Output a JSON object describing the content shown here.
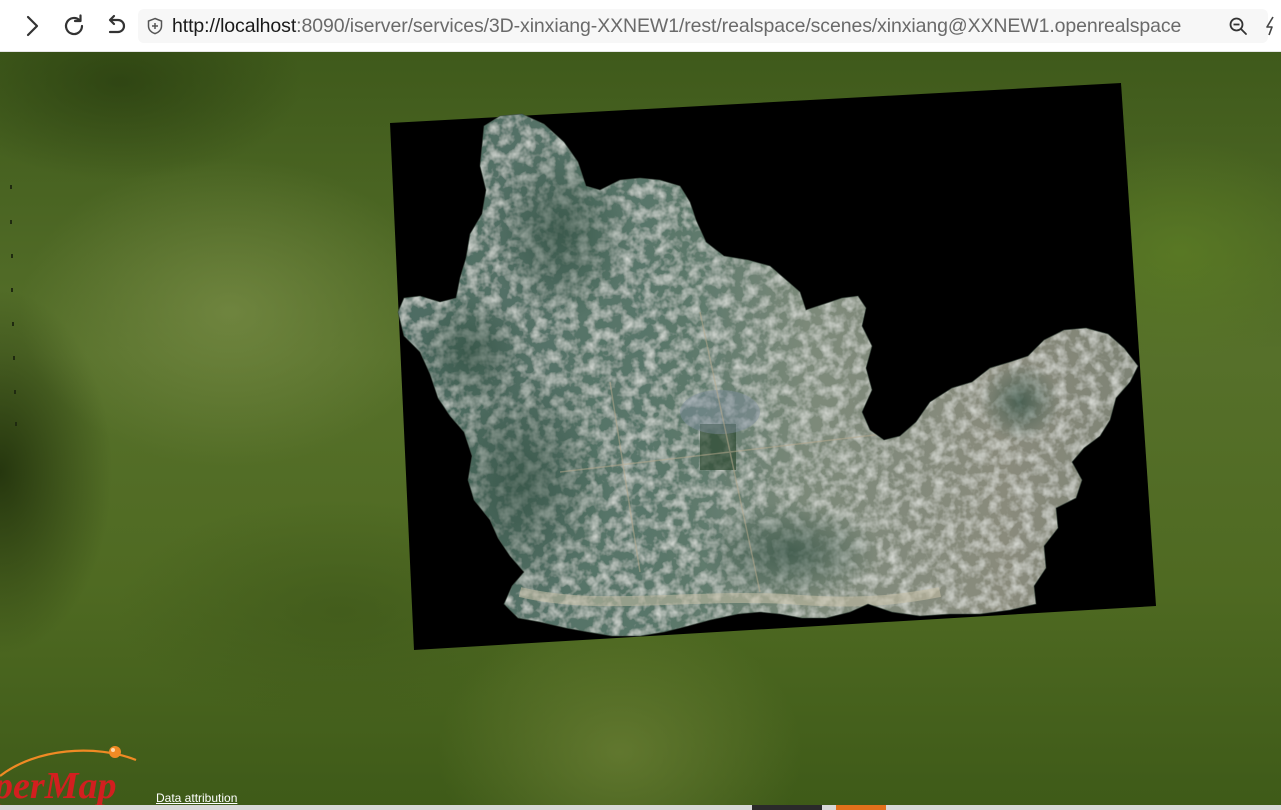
{
  "browser": {
    "url_host": "http://localhost",
    "url_rest": ":8090/iserver/services/3D-xinxiang-XXNEW1/rest/realspace/scenes/xinxiang@XXNEW1.openrealspace",
    "icons": {
      "forward": "chevron-right-icon",
      "reload": "reload-icon",
      "undo": "undo-icon",
      "site_info": "shield-plus-icon",
      "zoom": "zoom-out-icon",
      "extra": "lightning-icon"
    }
  },
  "scene": {
    "logo_text": "perMap",
    "attribution": "Data attribution",
    "colors": {
      "terrain": "#4a6420",
      "imagery_frame": "#000000",
      "logo_red": "#d21f1f",
      "logo_orange": "#f08a24"
    }
  }
}
